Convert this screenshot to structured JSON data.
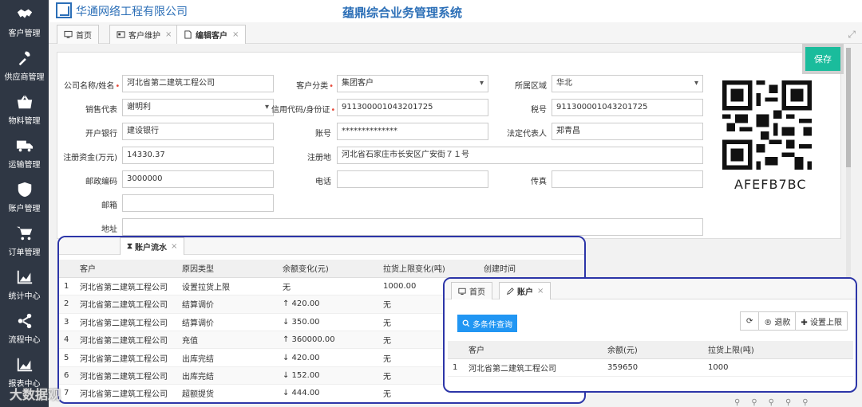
{
  "sidebar": {
    "items": [
      {
        "label": "客户管理",
        "icon": "handshake-icon"
      },
      {
        "label": "供应商管理",
        "icon": "tools-icon"
      },
      {
        "label": "物料管理",
        "icon": "basket-icon"
      },
      {
        "label": "运输管理",
        "icon": "truck-icon"
      },
      {
        "label": "账户管理",
        "icon": "shield-icon"
      },
      {
        "label": "订单管理",
        "icon": "cart-icon"
      },
      {
        "label": "统计中心",
        "icon": "area-chart-icon"
      },
      {
        "label": "流程中心",
        "icon": "share-icon"
      },
      {
        "label": "报表中心",
        "icon": "area-chart-icon"
      }
    ]
  },
  "header": {
    "company": "华通网络工程有限公司",
    "system_title": "蕴鼎综合业务管理系统"
  },
  "tabs": [
    {
      "label": "首页",
      "icon": "monitor-icon"
    },
    {
      "label": "客户维护",
      "icon": "id-card-icon"
    },
    {
      "label": "编辑客户",
      "icon": "edit-document-icon"
    }
  ],
  "form": {
    "save_label": "保存",
    "company_name": {
      "label": "公司名称/姓名",
      "value": "河北省第二建筑工程公司"
    },
    "customer_type": {
      "label": "客户分类",
      "value": "集团客户"
    },
    "region": {
      "label": "所属区域",
      "value": "华北"
    },
    "sales_rep": {
      "label": "销售代表",
      "value": "谢明利"
    },
    "credit_code": {
      "label": "信用代码/身份证",
      "value": "911300001043201725"
    },
    "tax_no": {
      "label": "税号",
      "value": "911300001043201725"
    },
    "bank": {
      "label": "开户银行",
      "value": "建设银行"
    },
    "account_no": {
      "label": "账号",
      "value": "**************"
    },
    "legal_rep": {
      "label": "法定代表人",
      "value": "郑青昌"
    },
    "reg_capital": {
      "label": "注册资金(万元)",
      "value": "14330.37"
    },
    "reg_address": {
      "label": "注册地",
      "value": "河北省石家庄市长安区广安街７１号"
    },
    "postal_code": {
      "label": "邮政编码",
      "value": "3000000"
    },
    "phone": {
      "label": "电话",
      "value": ""
    },
    "fax": {
      "label": "传真",
      "value": ""
    },
    "email": {
      "label": "邮箱",
      "value": ""
    },
    "address": {
      "label": "地址",
      "value": ""
    },
    "qr_code_text": "AFEFB7BC"
  },
  "flow_panel": {
    "tab_label": "账户流水",
    "columns": [
      "",
      "客户",
      "原因类型",
      "余额变化(元)",
      "拉货上限变化(吨)",
      "创建时间"
    ],
    "rows": [
      [
        "1",
        "河北省第二建筑工程公司",
        "设置拉货上限",
        "无",
        "1000.00",
        ""
      ],
      [
        "2",
        "河北省第二建筑工程公司",
        "结算调价",
        "↑ 420.00",
        "无",
        ""
      ],
      [
        "3",
        "河北省第二建筑工程公司",
        "结算调价",
        "↓ 350.00",
        "无",
        ""
      ],
      [
        "4",
        "河北省第二建筑工程公司",
        "充值",
        "↑ 360000.00",
        "无",
        ""
      ],
      [
        "5",
        "河北省第二建筑工程公司",
        "出库完结",
        "↓ 420.00",
        "无",
        ""
      ],
      [
        "6",
        "河北省第二建筑工程公司",
        "出库完结",
        "↓ 152.00",
        "无",
        ""
      ],
      [
        "7",
        "河北省第二建筑工程公司",
        "超额提货",
        "↓ 444.00",
        "无",
        ""
      ]
    ]
  },
  "account_panel": {
    "tabs": [
      {
        "label": "首页",
        "icon": "monitor-icon"
      },
      {
        "label": "账户",
        "icon": "edit-icon"
      }
    ],
    "query_label": "多条件查询",
    "refund_label": "退款",
    "set_limit_label": "设置上限",
    "columns": [
      "",
      "客户",
      "余额(元)",
      "拉货上限(吨)"
    ],
    "rows": [
      [
        "1",
        "河北省第二建筑工程公司",
        "359650",
        "1000"
      ]
    ]
  },
  "watermark": "大数据观"
}
